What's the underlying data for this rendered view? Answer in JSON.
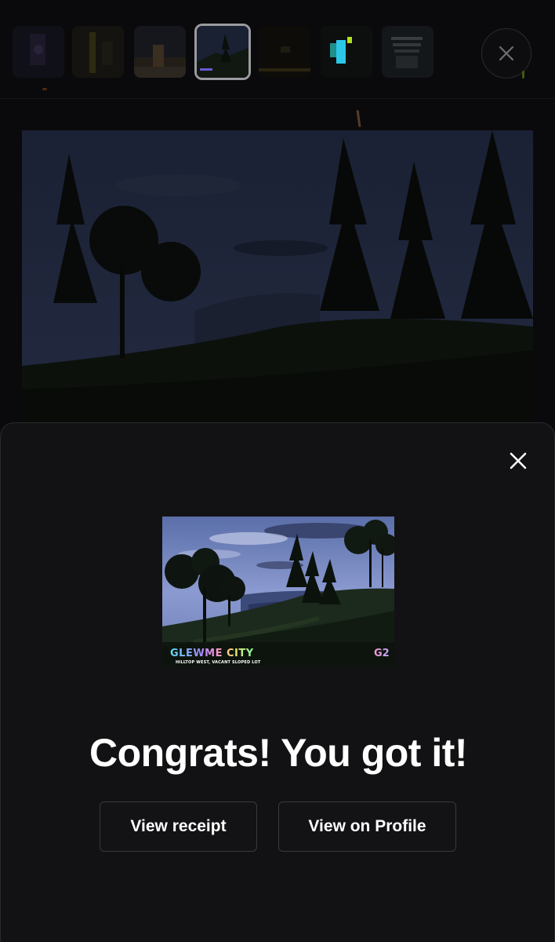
{
  "gallery": {
    "thumbnails": [
      {
        "name": "thumb-1",
        "active": false
      },
      {
        "name": "thumb-2",
        "active": false
      },
      {
        "name": "thumb-3",
        "active": false
      },
      {
        "name": "thumb-4",
        "active": true
      },
      {
        "name": "thumb-5",
        "active": false
      },
      {
        "name": "thumb-6",
        "active": false
      },
      {
        "name": "thumb-7",
        "active": false
      }
    ],
    "close_icon": "close-icon"
  },
  "modal": {
    "close_icon": "close-icon",
    "nft": {
      "brand": "GLEWME CITY",
      "subtitle": "HILLTOP WEST, VACANT SLOPED LOT",
      "badge": "G2"
    },
    "headline": "Congrats! You got it!",
    "buttons": {
      "receipt": "View receipt",
      "profile": "View on Profile"
    }
  },
  "colors": {
    "background": "#0a0a0c",
    "sheet": "#121214",
    "text": "#ffffff",
    "button_border": "#38383e"
  }
}
